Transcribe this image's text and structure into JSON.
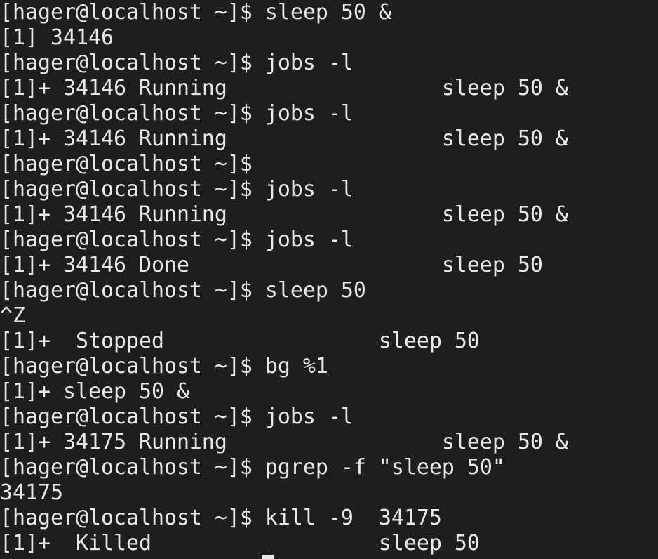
{
  "terminal": {
    "lines": [
      "[hager@localhost ~]$ sleep 50 &",
      "[1] 34146",
      "[hager@localhost ~]$ jobs -l",
      "[1]+ 34146 Running                 sleep 50 &",
      "[hager@localhost ~]$ jobs -l",
      "[1]+ 34146 Running                 sleep 50 &",
      "[hager@localhost ~]$",
      "[hager@localhost ~]$ jobs -l",
      "[1]+ 34146 Running                 sleep 50 &",
      "[hager@localhost ~]$ jobs -l",
      "[1]+ 34146 Done                    sleep 50",
      "[hager@localhost ~]$ sleep 50",
      "^Z",
      "[1]+  Stopped                 sleep 50",
      "[hager@localhost ~]$ bg %1",
      "[1]+ sleep 50 &",
      "[hager@localhost ~]$ jobs -l",
      "[1]+ 34175 Running                 sleep 50 &",
      "[hager@localhost ~]$ pgrep -f \"sleep 50\"",
      "34175",
      "[hager@localhost ~]$ kill -9  34175",
      "[1]+  Killed                  sleep 50"
    ]
  },
  "colors": {
    "background": "#1e1e1e",
    "foreground": "#e8e8e8"
  }
}
